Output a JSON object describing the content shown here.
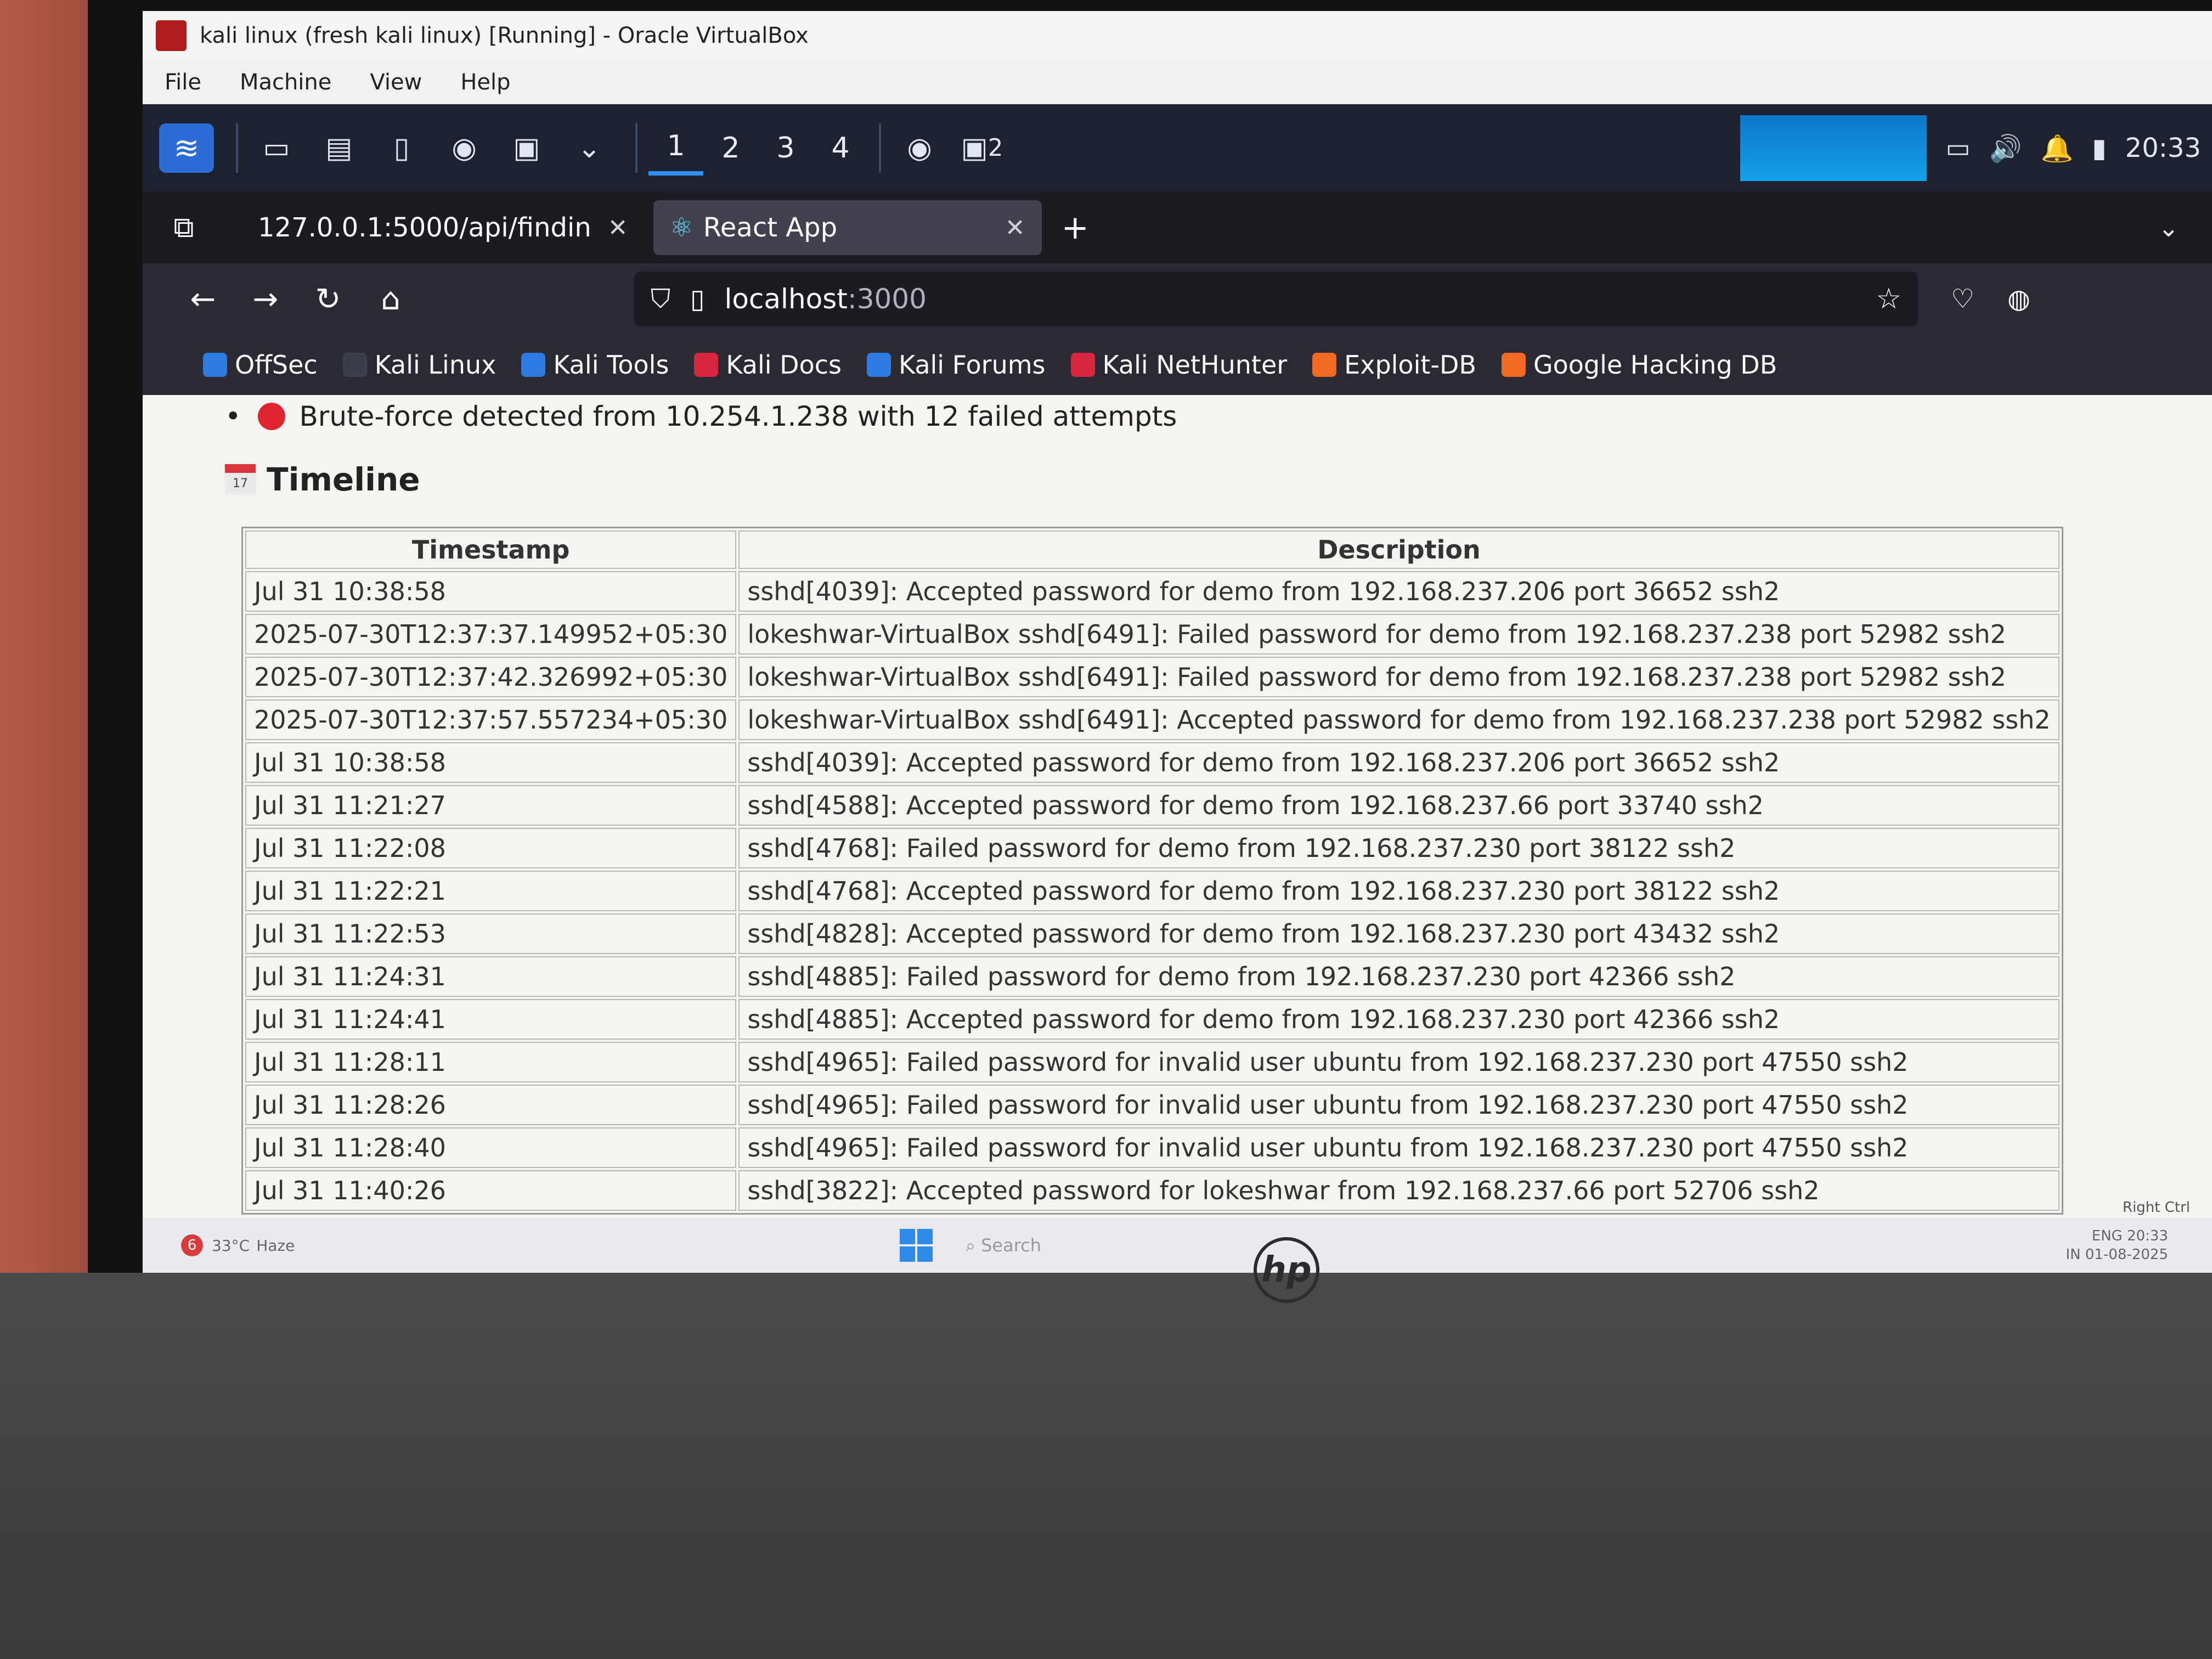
{
  "window": {
    "title": "kali linux (fresh kali linux) [Running] - Oracle VirtualBox",
    "menu": [
      "File",
      "Machine",
      "View",
      "Help"
    ]
  },
  "kali_panel": {
    "workspaces": [
      "1",
      "2",
      "3",
      "4"
    ],
    "terminal_badge": "2",
    "clock": "20:33"
  },
  "browser": {
    "tabs": [
      {
        "title": "127.0.0.1:5000/api/findin",
        "active": false
      },
      {
        "title": "React App",
        "active": true
      }
    ],
    "url_host": "localhost",
    "url_port": ":3000",
    "bookmarks": [
      {
        "label": "OffSec",
        "color": "#2d7be0"
      },
      {
        "label": "Kali Linux",
        "color": "#3a3f4b"
      },
      {
        "label": "Kali Tools",
        "color": "#2d7be0"
      },
      {
        "label": "Kali Docs",
        "color": "#d7263d"
      },
      {
        "label": "Kali Forums",
        "color": "#2d7be0"
      },
      {
        "label": "Kali NetHunter",
        "color": "#d7263d"
      },
      {
        "label": "Exploit-DB",
        "color": "#f26a21"
      },
      {
        "label": "Google Hacking DB",
        "color": "#f26a21"
      }
    ]
  },
  "page": {
    "alert": "Brute-force detected from 10.254.1.238 with 12 failed attempts",
    "timeline_heading": "Timeline",
    "calendar_day": "17",
    "table": {
      "headers": [
        "Timestamp",
        "Description"
      ],
      "rows": [
        {
          "ts": "Jul 31 10:38:58",
          "desc": "sshd[4039]: Accepted password for demo from 192.168.237.206 port 36652 ssh2"
        },
        {
          "ts": "2025-07-30T12:37:37.149952+05:30",
          "desc": "lokeshwar-VirtualBox sshd[6491]: Failed password for demo from 192.168.237.238 port 52982 ssh2"
        },
        {
          "ts": "2025-07-30T12:37:42.326992+05:30",
          "desc": "lokeshwar-VirtualBox sshd[6491]: Failed password for demo from 192.168.237.238 port 52982 ssh2"
        },
        {
          "ts": "2025-07-30T12:37:57.557234+05:30",
          "desc": "lokeshwar-VirtualBox sshd[6491]: Accepted password for demo from 192.168.237.238 port 52982 ssh2"
        },
        {
          "ts": "Jul 31 10:38:58",
          "desc": "sshd[4039]: Accepted password for demo from 192.168.237.206 port 36652 ssh2"
        },
        {
          "ts": "Jul 31 11:21:27",
          "desc": "sshd[4588]: Accepted password for demo from 192.168.237.66 port 33740 ssh2"
        },
        {
          "ts": "Jul 31 11:22:08",
          "desc": "sshd[4768]: Failed password for demo from 192.168.237.230 port 38122 ssh2"
        },
        {
          "ts": "Jul 31 11:22:21",
          "desc": "sshd[4768]: Accepted password for demo from 192.168.237.230 port 38122 ssh2"
        },
        {
          "ts": "Jul 31 11:22:53",
          "desc": "sshd[4828]: Accepted password for demo from 192.168.237.230 port 43432 ssh2"
        },
        {
          "ts": "Jul 31 11:24:31",
          "desc": "sshd[4885]: Failed password for demo from 192.168.237.230 port 42366 ssh2"
        },
        {
          "ts": "Jul 31 11:24:41",
          "desc": "sshd[4885]: Accepted password for demo from 192.168.237.230 port 42366 ssh2"
        },
        {
          "ts": "Jul 31 11:28:11",
          "desc": "sshd[4965]: Failed password for invalid user ubuntu from 192.168.237.230 port 47550 ssh2"
        },
        {
          "ts": "Jul 31 11:28:26",
          "desc": "sshd[4965]: Failed password for invalid user ubuntu from 192.168.237.230 port 47550 ssh2"
        },
        {
          "ts": "Jul 31 11:28:40",
          "desc": "sshd[4965]: Failed password for invalid user ubuntu from 192.168.237.230 port 47550 ssh2"
        },
        {
          "ts": "Jul 31 11:40:26",
          "desc": "sshd[3822]: Accepted password for lokeshwar from 192.168.237.66 port 52706 ssh2"
        }
      ]
    }
  },
  "host_taskbar": {
    "weather_badge": "6",
    "temperature": "33°C",
    "weather": "Haze",
    "search_placeholder": "Search",
    "lang": "ENG",
    "region": "IN",
    "time": "20:33",
    "date": "01-08-2025",
    "right_ctrl": "Right Ctrl"
  },
  "keyboard": {
    "brand": "hp"
  },
  "colors": {
    "alert_dot": "#e0242f",
    "panel_bg": "#1d2230",
    "firefox_toolbar": "#2b2a33"
  }
}
